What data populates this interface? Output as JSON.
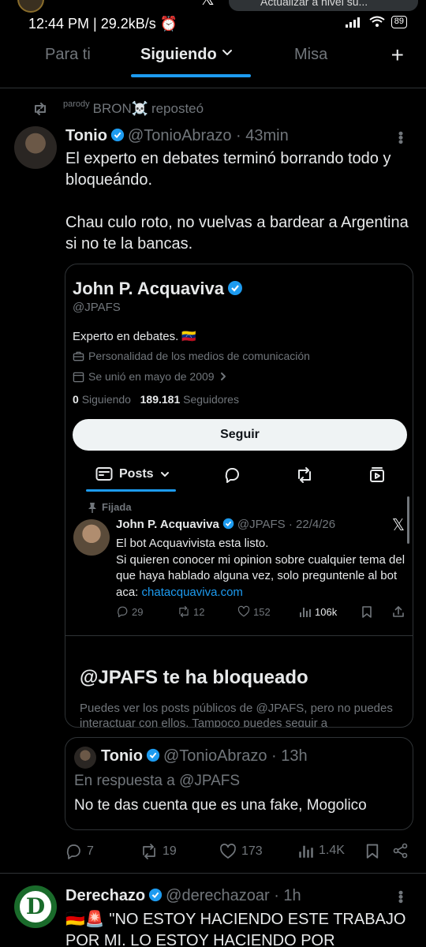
{
  "status_bar": {
    "time": "12:44 PM | 29.2kB/s",
    "battery": "89",
    "notification": "Actualizar a nivel su..."
  },
  "tabs": {
    "for_you": "Para ti",
    "following": "Siguiendo",
    "list": "Misa"
  },
  "repost": {
    "badge": "parody",
    "user": "BRON☠️",
    "suffix": "reposteó"
  },
  "post": {
    "name": "Tonio",
    "handle": "@TonioAbrazo",
    "time": "43min",
    "text": "El experto en debates terminó borrando todo y bloqueándo.\n\nChau culo roto, no vuelvas a bardear a Argentina si no te la bancas."
  },
  "profile_card": {
    "name": "John P. Acquaviva",
    "handle": "@JPAFS",
    "bio": "Experto en debates. 🇻🇪",
    "category": "Personalidad de los medios de comunicación",
    "joined": "Se unió en mayo de 2009",
    "following_count": "0",
    "following_label": "Siguiendo",
    "followers_count": "189.181",
    "followers_label": "Seguidores",
    "follow_button": "Seguir",
    "posts_tab": "Posts",
    "pinned_label": "Fijada",
    "pinned_post": {
      "name": "John P. Acquaviva",
      "handle": "@JPAFS",
      "date": "22/4/26",
      "line1": "El bot Acquavivista esta listo.",
      "line2": "Si quieren conocer mi opinion sobre cualquier tema del que haya hablado alguna vez, solo preguntenle al bot aca:",
      "link": "chatacquaviva.com",
      "replies": "29",
      "reposts": "12",
      "likes": "152",
      "views": "106k"
    },
    "blocked_title": "@JPAFS te ha bloqueado",
    "blocked_text": "Puedes ver los posts públicos de @JPAFS, pero no puedes interactuar con ellos. Tampoco puedes seguir a"
  },
  "reply_quote": {
    "name": "Tonio",
    "handle": "@TonioAbrazo",
    "time": "13h",
    "reply_to": "En respuesta a @JPAFS",
    "text": "No te das cuenta que es una fake, Mogolico"
  },
  "post_actions": {
    "replies": "7",
    "reposts": "19",
    "likes": "173",
    "views": "1.4K"
  },
  "next_post": {
    "name": "Derechazo",
    "handle": "@derechazoar",
    "time": "1h",
    "avatar_letter": "D",
    "text": "🇩🇪🚨 \"NO ESTOY HACIENDO ESTE TRABAJO POR MI. LO ESTOY HACIENDO POR USTEDES\":"
  },
  "colors": {
    "accent": "#1d9bf0",
    "background": "#000000",
    "text": "#e7e9ea",
    "muted": "#71767b",
    "border": "#2f3336"
  }
}
